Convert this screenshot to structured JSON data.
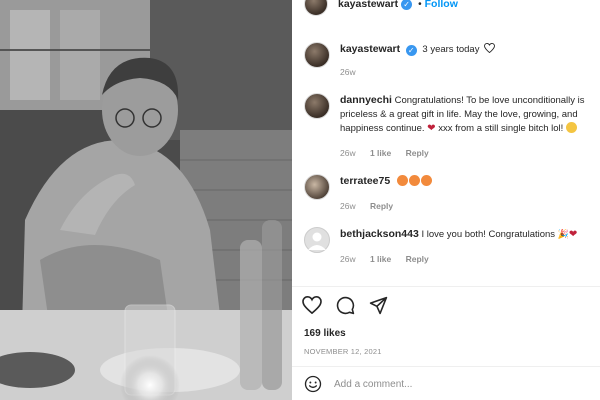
{
  "header": {
    "username": "kayastewart",
    "verified_symbol": "✓",
    "separator": "•",
    "follow_label": "Follow"
  },
  "caption": {
    "username": "kayastewart",
    "text": "3 years today",
    "time": "26w"
  },
  "comments": [
    {
      "username": "dannyechi",
      "text": "Congratulations! To be love unconditionally is priceless & a great gift in life. May the love, growing, and happiness continue.",
      "text_tail": "xxx from a still single bitch lol!",
      "time": "26w",
      "likes": "1 like",
      "reply": "Reply"
    },
    {
      "username": "terratee75",
      "text": "",
      "time": "26w",
      "reply": "Reply"
    },
    {
      "username": "bethjackson443",
      "text": "I love you both! Congratulations",
      "time": "26w",
      "likes": "1 like",
      "reply": "Reply"
    }
  ],
  "post": {
    "likes": "169 likes",
    "date": "NOVEMBER 12, 2021"
  },
  "add_comment": {
    "placeholder": "Add a comment..."
  },
  "icons": [
    "heart-icon",
    "comment-icon",
    "share-icon",
    "smiley-icon",
    "verified-icon"
  ],
  "colors": {
    "link": "#0095f6",
    "verified": "#3897f0",
    "muted": "#8e8e8e",
    "text": "#262626"
  }
}
